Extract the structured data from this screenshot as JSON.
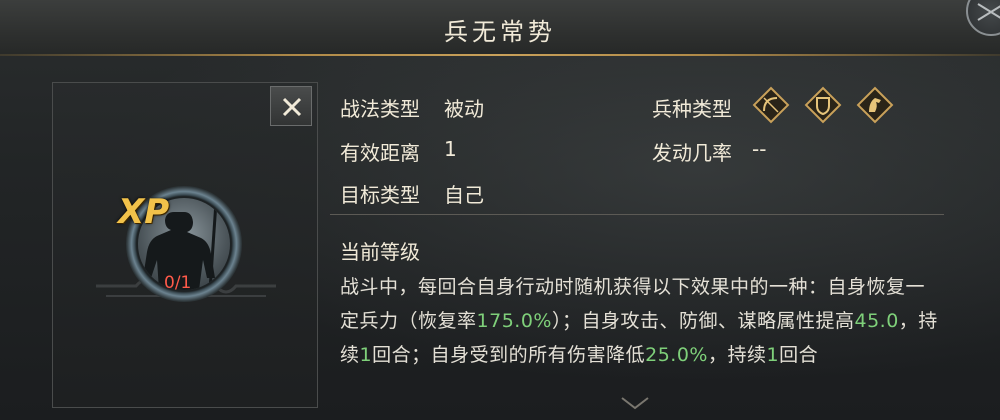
{
  "header": {
    "title": "兵无常势"
  },
  "close_label": "✕",
  "xp": {
    "label": "XP",
    "count": "0/1"
  },
  "fields": {
    "tactic_type_label": "战法类型",
    "tactic_type_value": "被动",
    "range_label": "有效距离",
    "range_value": "1",
    "target_label": "目标类型",
    "target_value": "自己",
    "troop_type_label": "兵种类型",
    "trigger_rate_label": "发动几率",
    "trigger_rate_value": "--"
  },
  "troop_icons": [
    "archer-icon",
    "shield-icon",
    "cavalry-icon"
  ],
  "level": {
    "title": "当前等级"
  },
  "description": {
    "p1": "战斗中，每回合自身行动时随机获得以下效果中的一种：自身恢复一定兵力（恢复率",
    "n1": "175.0%",
    "p2": "）；自身攻击、防御、谋略属性提高",
    "n2": "45.0",
    "p3": "，持续",
    "n3": "1",
    "p4": "回合；自身受到的所有伤害降低",
    "n4": "25.0%",
    "p5": "，持续",
    "n5": "1",
    "p6": "回合"
  },
  "colors": {
    "accent_gold": "#c9a15a",
    "highlight_green": "#7fd07a",
    "xp_gold": "#f2c24a",
    "count_red": "#ff5a4a"
  }
}
